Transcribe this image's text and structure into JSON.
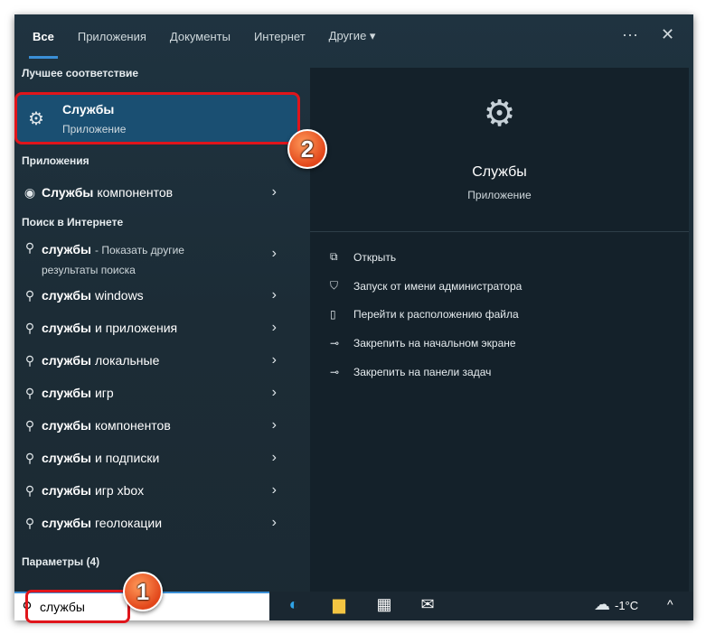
{
  "tabs": [
    "Все",
    "Приложения",
    "Документы",
    "Интернет",
    "Другие ▾"
  ],
  "more_label": "···",
  "close_label": "✕",
  "best_match": {
    "heading": "Лучшее соответствие",
    "title": "Службы",
    "subtitle": "Приложение"
  },
  "apps": {
    "heading": "Приложения",
    "items": [
      {
        "bold": "Службы",
        "rest": "компонентов"
      }
    ]
  },
  "web": {
    "heading": "Поиск в Интернете",
    "first": {
      "bold": "службы",
      "rest": "- Показать другие",
      "line2": "результаты поиска"
    },
    "items": [
      {
        "bold": "службы",
        "rest": "windows"
      },
      {
        "bold": "службы",
        "rest": "и приложения"
      },
      {
        "bold": "службы",
        "rest": "локальные"
      },
      {
        "bold": "службы",
        "rest": "игр"
      },
      {
        "bold": "службы",
        "rest": "компонентов"
      },
      {
        "bold": "службы",
        "rest": "и подписки"
      },
      {
        "bold": "службы",
        "rest": "игр xbox"
      },
      {
        "bold": "службы",
        "rest": "геолокации"
      }
    ]
  },
  "settings_heading": "Параметры (4)",
  "preview": {
    "title": "Службы",
    "subtitle": "Приложение",
    "actions": [
      "Открыть",
      "Запуск от имени администратора",
      "Перейти к расположению файла",
      "Закрепить на начальном экране",
      "Закрепить на панели задач"
    ]
  },
  "search": {
    "value": "службы"
  },
  "weather": "-1°C",
  "badges": [
    "1",
    "2"
  ]
}
